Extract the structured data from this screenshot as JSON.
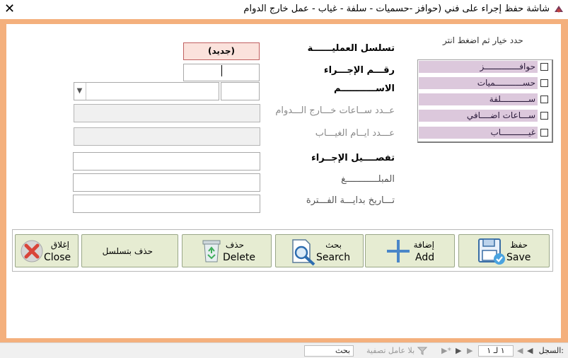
{
  "window": {
    "title": "شاشة حفظ إجراء على فني (حوافز -حسميات - سلفة - غياب - عمل خارج الدوام",
    "close": "✕"
  },
  "form": {
    "serial_label": "تسلسل العمليــــــة",
    "serial_value": "(جديد)",
    "proc_no_label": "رقـــم الإجـــراء",
    "name_label": "الاســـــــــــم",
    "overtime_label": "عــدد ســاعات خـــارج الـــدوام",
    "absence_label": "عـــدد ايــام الغيـــاب",
    "detail_label": "تفصــــيل الإجــراء",
    "amount_label": "المبلــــــــــــغ",
    "start_date_label": "تـــاريخ بدايـــة الفـــترة"
  },
  "choices": {
    "title": "حدد خيار ثم اضغط انتر",
    "items": [
      "حوافــــــــــــــز",
      "حســـــــــــميات",
      "ســـــــــــلفة",
      "ســـاعات اضــــافي",
      "غيـــــــــــاب"
    ]
  },
  "buttons": {
    "save": {
      "ar": "حفظ",
      "en": "Save"
    },
    "add": {
      "ar": "إضافة",
      "en": "Add"
    },
    "search": {
      "ar": "بحث",
      "en": "Search"
    },
    "delete": {
      "ar": "حذف",
      "en": "Delete"
    },
    "delete_serial": "حذف بتسلسل",
    "close": {
      "ar": "إغلاق",
      "en": "Close"
    }
  },
  "statusbar": {
    "record_label": "السجل:",
    "record_pos": "١ لـ ١",
    "first": "◀",
    "prev": "◀",
    "next": "▶",
    "last": "▶",
    "new": "▶*",
    "filter": "بلا عامل تصفية",
    "search": "بحث"
  },
  "colors": {
    "frame": "#f4b07d",
    "option_bg": "#dcc8dc",
    "button_bg": "#e6ecd2",
    "serial_bg": "#fbe2dc"
  }
}
